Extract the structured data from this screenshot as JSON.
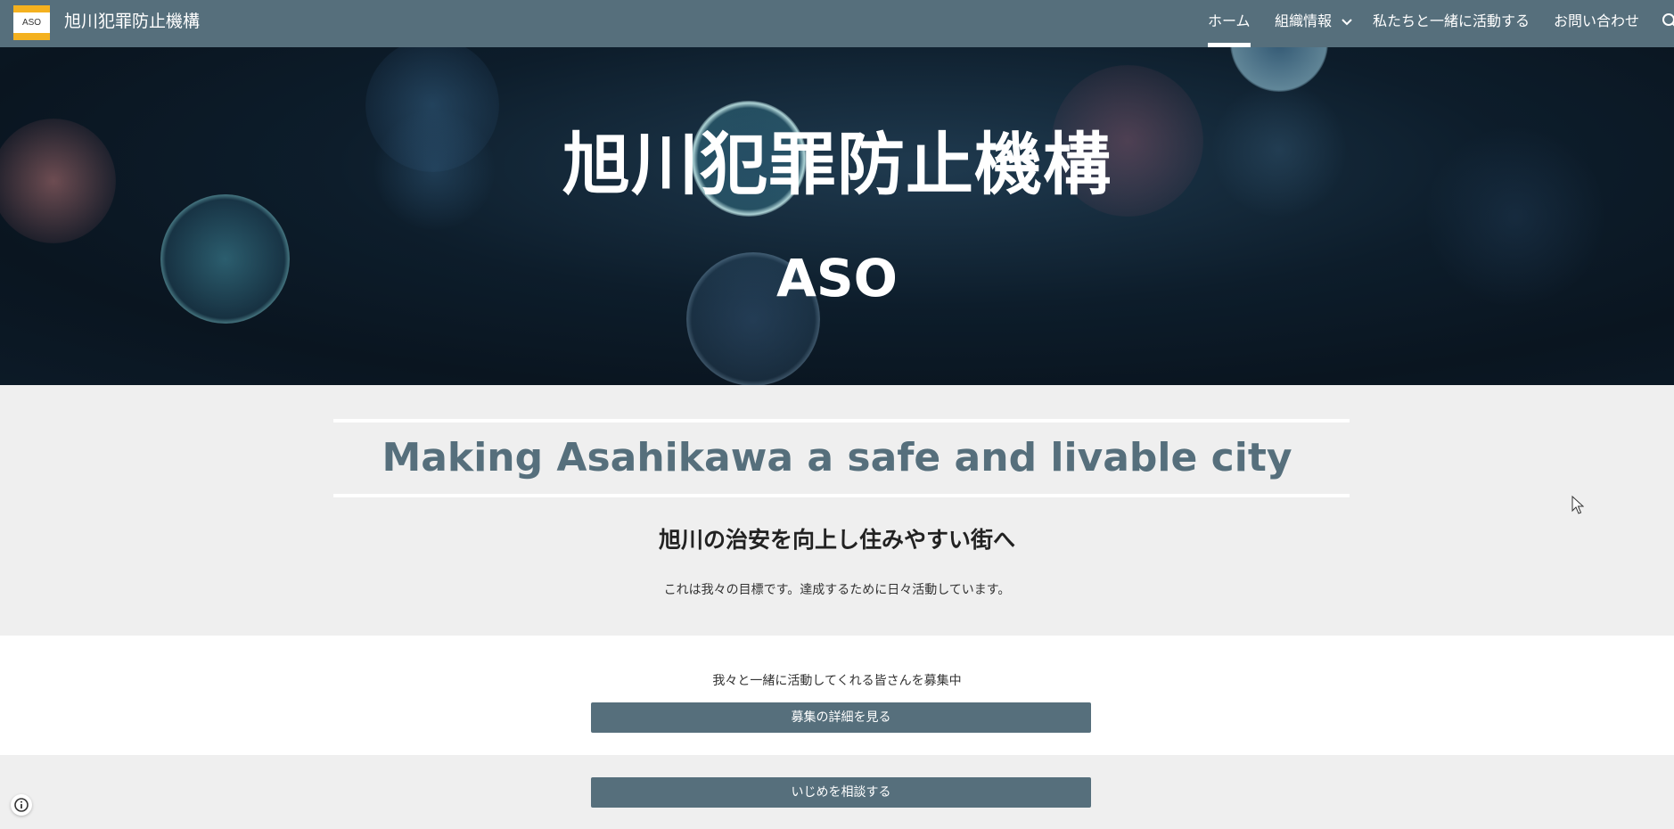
{
  "site": {
    "logo_text": "ASO",
    "title": "旭川犯罪防止機構"
  },
  "nav": {
    "items": [
      {
        "label": "ホーム",
        "active": true
      },
      {
        "label": "組織情報",
        "has_dropdown": true
      },
      {
        "label": "私たちと一緒に活動する"
      },
      {
        "label": "お問い合わせ"
      }
    ],
    "search_icon": "search-icon"
  },
  "hero": {
    "title": "旭川犯罪防止機構",
    "subtitle": "ASO"
  },
  "intro": {
    "tagline": "Making Asahikawa a safe and livable city",
    "heading": "旭川の治安を向上し住みやすい街へ",
    "body": "これは我々の目標です。達成するために日々活動しています。"
  },
  "recruit": {
    "text": "我々と一緒に活動してくれる皆さんを募集中",
    "button_label": "募集の詳細を見る"
  },
  "consult": {
    "button_label": "いじめを相談する"
  },
  "colors": {
    "nav_bg": "#566f7c",
    "accent": "#566f7c",
    "logo_bg": "#f4b11f",
    "page_bg": "#efefef"
  }
}
